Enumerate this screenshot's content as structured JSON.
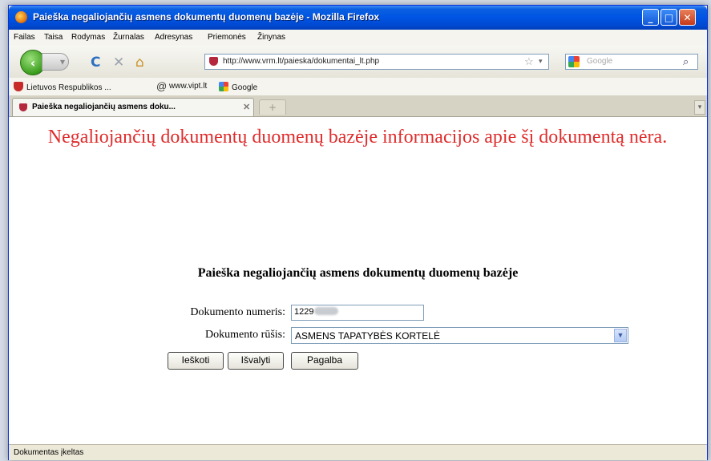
{
  "window": {
    "title": "Paieška negaliojančių asmens dokumentų duomenų bazėje - Mozilla Firefox"
  },
  "menu": {
    "items": [
      "Failas",
      "Taisa",
      "Rodymas",
      "Žurnalas",
      "Adresynas",
      "Priemonės",
      "Žinynas"
    ]
  },
  "navigation": {
    "url": "http://www.vrm.lt/paieska/dokumentai_lt.php",
    "search_placeholder": "Google"
  },
  "bookmarks": [
    {
      "label": "Lietuvos Respublikos ...",
      "icon": "shield-icon"
    },
    {
      "label": "www.vipt.lt",
      "icon": "at-icon"
    },
    {
      "label": "Google",
      "icon": "google-icon"
    }
  ],
  "tab": {
    "label": "Paieška negaliojančių asmens doku...",
    "new_tab": "+"
  },
  "page": {
    "error_message": "Negaliojančių dokumentų duomenų bazėje informacijos apie šį dokumentą nėra.",
    "form_title": "Paieška negaliojančių asmens dokumentų duomenų bazėje",
    "number_label": "Dokumento numeris:",
    "number_value": "1229",
    "type_label": "Dokumento rūšis:",
    "type_value": "ASMENS TAPATYBĖS KORTELĖ",
    "search_button": "Ieškoti",
    "clear_button": "Išvalyti",
    "help_button": "Pagalba"
  },
  "status": {
    "text": "Dokumentas įkeltas"
  },
  "colors": {
    "error_text": "#e02c2c",
    "titlebar": "#0054e3"
  }
}
